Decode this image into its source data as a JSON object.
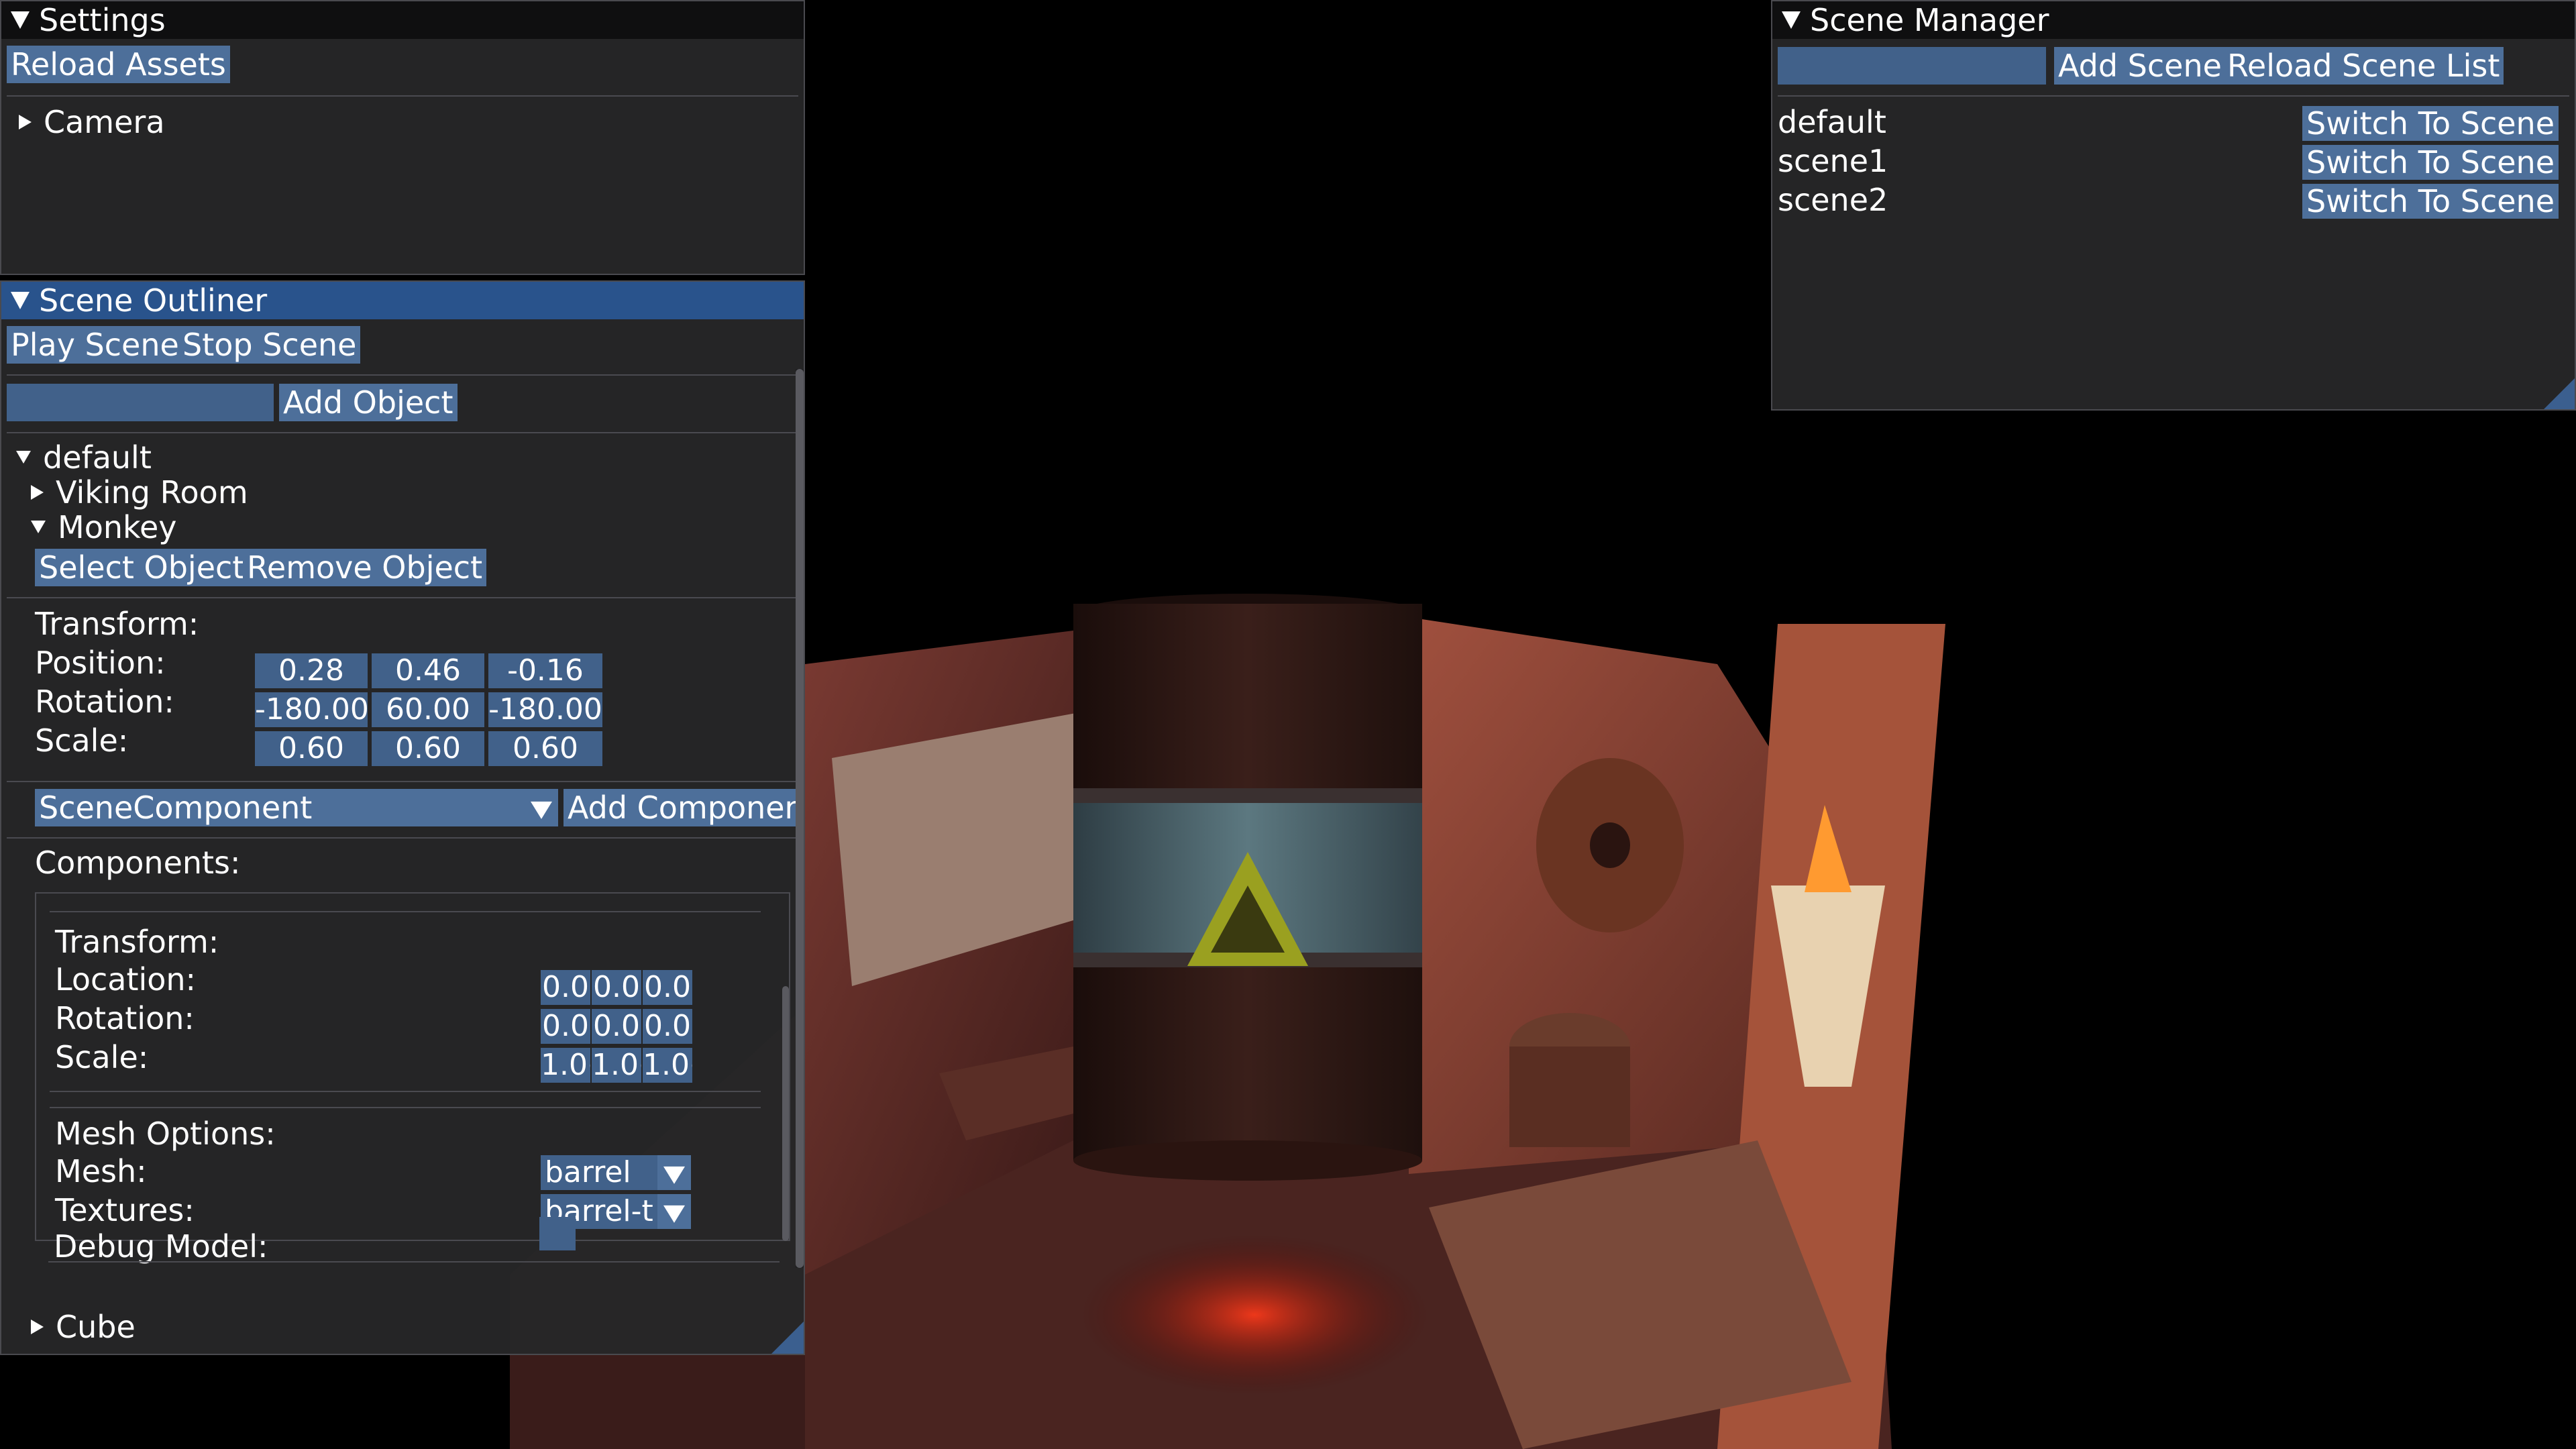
{
  "settings": {
    "title": "Settings",
    "reload_assets": "Reload Assets",
    "camera": "Camera"
  },
  "outliner": {
    "title": "Scene Outliner",
    "play_scene": "Play Scene",
    "stop_scene": "Stop Scene",
    "object_name_value": "",
    "add_object": "Add Object",
    "scene_root": "default",
    "objects": [
      "Viking Room",
      "Monkey",
      "Cube"
    ],
    "select_object": "Select Object",
    "remove_object": "Remove Object",
    "transform_header": "Transform:",
    "position_label": "Position:",
    "rotation_label": "Rotation:",
    "scale_label": "Scale:",
    "position": [
      "0.28",
      "0.46",
      "-0.16"
    ],
    "rotation": [
      "-180.00",
      "60.00",
      "-180.00"
    ],
    "scale": [
      "0.60",
      "0.60",
      "0.60"
    ],
    "component_type": "SceneComponent",
    "add_component": "Add Componen",
    "components_header": "Components:",
    "component": {
      "transform_header": "Transform:",
      "location_label": "Location:",
      "rotation_label": "Rotation:",
      "scale_label": "Scale:",
      "location": [
        "0.0",
        "0.0",
        "0.0"
      ],
      "rotation": [
        "0.0",
        "0.0",
        "0.0"
      ],
      "scale": [
        "1.0(",
        "1.0(",
        "1.0("
      ],
      "mesh_options_header": "Mesh Options:",
      "mesh_label": "Mesh:",
      "mesh_value": "barrel",
      "textures_label": "Textures:",
      "textures_value": "barrel-t",
      "debug_model_label": "Debug Model:",
      "debug_model_checked": false
    }
  },
  "scene_manager": {
    "title": "Scene Manager",
    "scene_name_value": "",
    "add_scene": "Add Scene",
    "reload_scene_list": "Reload Scene List",
    "scenes": [
      {
        "name": "default",
        "button": "Switch To Scene"
      },
      {
        "name": "scene1",
        "button": "Switch To Scene"
      },
      {
        "name": "scene2",
        "button": "Switch To Scene"
      }
    ]
  },
  "colors": {
    "accent_button": "#4d6f9a",
    "active_title": "#29538c",
    "window_bg": "#262628"
  }
}
